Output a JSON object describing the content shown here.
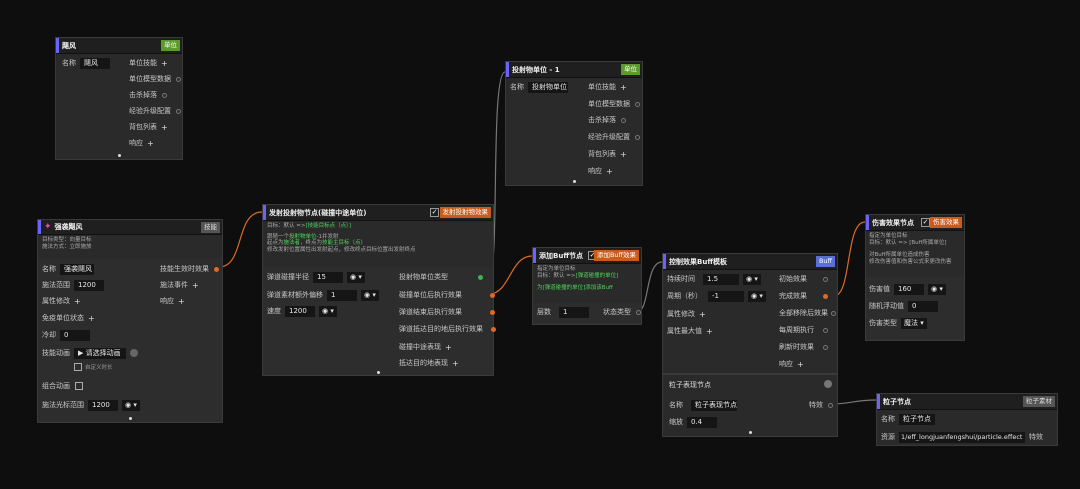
{
  "nodes": {
    "hurricane": {
      "title": "飓风",
      "tag": "单位",
      "name_label": "名称",
      "name_value": "飓风",
      "pins": [
        "单位技能",
        "单位模型数据",
        "击杀掉落",
        "经验升级配置",
        "背包列表",
        "响应"
      ]
    },
    "strengthen": {
      "title": "强袭飓风",
      "tag": "技能",
      "desc": [
        "目标类型：向量目标",
        "施法方式：立即施放"
      ],
      "name_label": "名称",
      "name_value": "强袭飓风",
      "range_label": "施法范围",
      "range_value": "1200",
      "attr_label": "属性修改",
      "cooldown_state_label": "免疫单位状态",
      "cd_label": "冷却",
      "cd_value": "0",
      "anim_label": "技能动画",
      "anim_value": "请选择动画",
      "custom_anim": "自定义时长",
      "combo_label": "组合动画",
      "cursor_label": "施法光标范围",
      "cursor_value": "1200",
      "right_pins": [
        "技能生效时效果",
        "施法事件",
        "响应"
      ]
    },
    "launcher": {
      "title": "发射投射物节点(碰撞中途单位)",
      "check": "✓",
      "tag": "发射投射物效果",
      "desc1": "目标：默认 =>",
      "desc1_g": "[技能目标点（点）]",
      "desc2": "跟随一个",
      "desc2_g": "投射物单位",
      "desc2_t": "-1并发射",
      "desc3": "起点为",
      "desc3_g": "施法者",
      "desc3_t": "，终点为",
      "desc3_g2": "技能主目标（点）",
      "desc4": "修改发射位置属性出发射起点，修改终点目标位置出发射终点",
      "rows": [
        {
          "label": "弹道碰撞半径",
          "value": "15"
        },
        {
          "label": "弹道素材额外偏移",
          "value": "1"
        },
        {
          "label": "速度",
          "value": "1200"
        }
      ],
      "right_pins": [
        "投射物单位类型",
        "碰撞单位后执行效果",
        "弹道结束后执行效果",
        "弹道抵达目的地后执行效果",
        "碰撞中途表现",
        "抵达目的地表现"
      ]
    },
    "projectile": {
      "title": "投射物单位 - 1",
      "tag": "单位",
      "name_label": "名称",
      "name_value": "投射物单位",
      "pins": [
        "单位技能",
        "单位模型数据",
        "击杀掉落",
        "经验升级配置",
        "背包列表",
        "响应"
      ]
    },
    "addbuff": {
      "title": "添加Buff节点",
      "check": "✓",
      "tag": "添加Buff效果",
      "desc1": "指定为单位目标",
      "desc2": "目标：默认 =>",
      "desc2_g": "[弹道碰撞的单位]",
      "desc3_g": "为[弹道碰撞的单位]添加该Buff",
      "layers_label": "层数",
      "layers_value": "1",
      "state_label": "状态类型"
    },
    "control": {
      "title": "控制效果Buff模板",
      "tag": "Buff",
      "rows": [
        {
          "label": "持续时间",
          "value": "1.5"
        },
        {
          "label": "周期（秒）",
          "value": "-1"
        }
      ],
      "attr_label": "属性修改",
      "max_label": "属性最大值",
      "right_pins": [
        "初始效果",
        "完成效果",
        "全部移除后效果",
        "每周期执行",
        "刷新时效果",
        "响应"
      ]
    },
    "particle_show": {
      "title": "粒子表现节点",
      "name_label": "名称",
      "name_value": "粒子表现节点",
      "scale_label": "缩放",
      "scale_value": "0.4",
      "effect_label": "特效"
    },
    "damage": {
      "title": "伤害效果节点",
      "check": "✓",
      "tag": "伤害效果",
      "desc1": "指定为单位目标",
      "desc2": "目标：默认 => [Buff所属单位]",
      "desc3": "对Buff所属单位造成伤害",
      "desc4": "修改伤害值和伤害公式来更改伤害",
      "dmg_label": "伤害值",
      "dmg_value": "160",
      "float_label": "随机浮动值",
      "float_value": "0",
      "type_label": "伤害类型",
      "type_value": "魔法"
    },
    "particle": {
      "title": "粒子节点",
      "tag": "粒子素材",
      "name_label": "名称",
      "name_value": "粒子节点",
      "res_label": "资源",
      "res_value": "1/eff_longjuanfengshui/particle.effect",
      "fx_label": "特效"
    }
  },
  "colors": {
    "accent": "#6b63ff",
    "wire": "#e06a22",
    "green": "#3fb34f",
    "bg": "#0e0e0e"
  }
}
